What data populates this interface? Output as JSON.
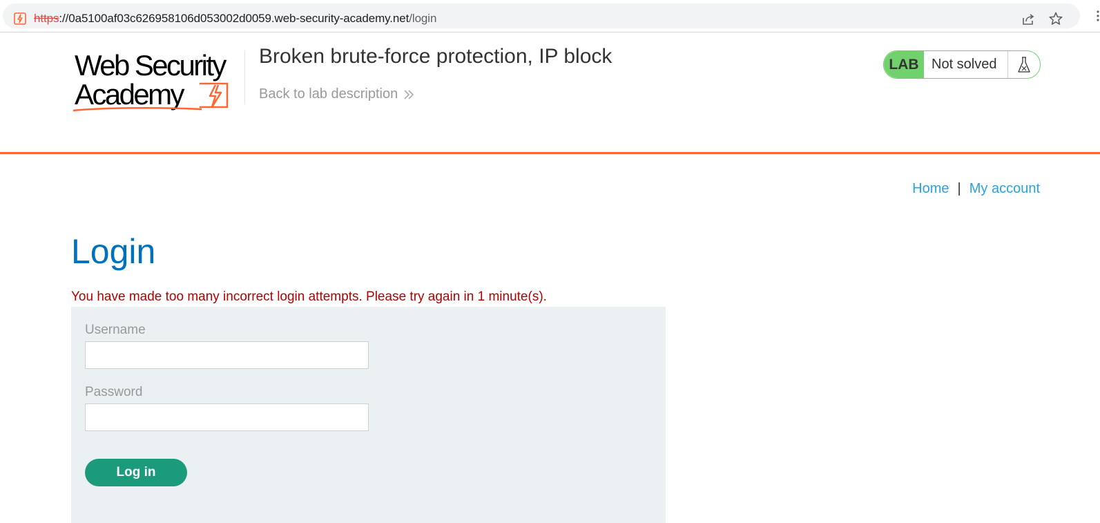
{
  "browser": {
    "url_scheme": "https",
    "url_host": "://0a5100af03c626958106d053002d0059.web-security-academy.net",
    "url_path": "/login",
    "site_icon": "lightning-bolt-icon",
    "actions": [
      "share-icon",
      "star-icon"
    ]
  },
  "header": {
    "logo_line1": "Web Security",
    "logo_line2": "Academy",
    "lab_title": "Broken brute-force protection, IP block",
    "back_link": "Back to lab description",
    "lab_tag": "LAB",
    "lab_status": "Not solved"
  },
  "nav": {
    "home": "Home",
    "separator": "|",
    "my_account": "My account"
  },
  "login": {
    "title": "Login",
    "error": "You have made too many incorrect login attempts. Please try again in 1 minute(s).",
    "username_label": "Username",
    "username_value": "",
    "password_label": "Password",
    "password_value": "",
    "submit_label": "Log in"
  },
  "colors": {
    "accent_orange": "#ff6633",
    "lab_green": "#70d16d",
    "title_blue": "#0071bc",
    "link_blue": "#29a3dd",
    "error_red": "#b50000",
    "button_green": "#1c9b7c",
    "panel_bg": "#ebf0f2"
  }
}
